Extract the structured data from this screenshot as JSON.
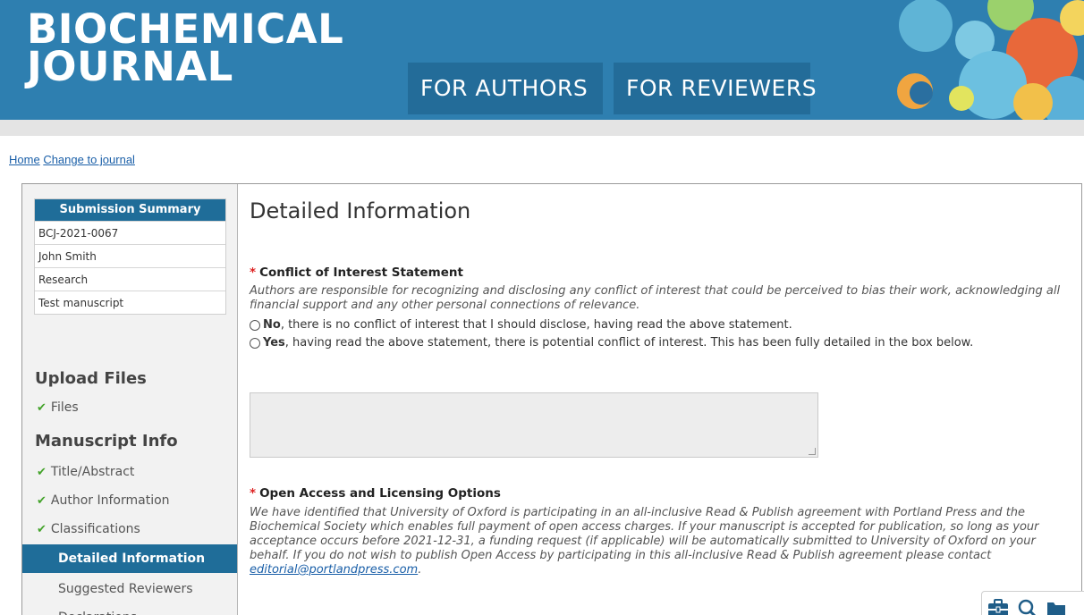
{
  "header": {
    "logo_line1": "BIOCHEMICAL",
    "logo_line2": "JOURNAL",
    "nav": [
      "FOR AUTHORS",
      "FOR REVIEWERS"
    ],
    "brand_color": "#2e7fb0"
  },
  "breadcrumb": {
    "home": "Home",
    "change": "Change to journal"
  },
  "sidebar": {
    "summary_title": "Submission Summary",
    "summary_rows": [
      "BCJ-2021-0067",
      "John Smith",
      "Research",
      "Test manuscript"
    ],
    "upload_title": "Upload Files",
    "upload_items": [
      {
        "label": "Files",
        "done": true
      }
    ],
    "info_title": "Manuscript Info",
    "info_items": [
      {
        "label": "Title/Abstract",
        "done": true
      },
      {
        "label": "Author Information",
        "done": true
      },
      {
        "label": "Classifications",
        "done": true
      },
      {
        "label": "Detailed Information",
        "active": true
      },
      {
        "label": "Suggested Reviewers"
      },
      {
        "label": "Declarations"
      }
    ]
  },
  "main": {
    "title": "Detailed Information",
    "required_mark": "*",
    "coi": {
      "title": "Conflict of Interest Statement",
      "description": "Authors are responsible for recognizing and disclosing any conflict of interest that could be perceived to bias their work, acknowledging all financial support and any other personal connections of relevance.",
      "option_no_bold": "No",
      "option_no_rest": ", there is no conflict of interest that I should disclose, having read the above statement.",
      "option_yes_bold": "Yes",
      "option_yes_rest": ", having read the above statement, there is potential conflict of interest. This has been fully detailed in the box below."
    },
    "open_access": {
      "title": "Open Access and Licensing Options",
      "description": "We have identified that University of Oxford is participating in an all-inclusive Read & Publish agreement with Portland Press and the Biochemical Society which enables full payment of open access charges. If your manuscript is accepted for publication, so long as your acceptance occurs before 2021-12-31, a funding request (if applicable) will be automatically submitted to University of Oxford on your behalf. If you do not wish to publish Open Access by participating in this all-inclusive Read & Publish agreement please contact ",
      "email": "editorial@portlandpress.com",
      "after_email": "."
    }
  },
  "floating_toolbar": {
    "icons": [
      "briefcase-icon",
      "search-icon",
      "folder-icon"
    ]
  }
}
